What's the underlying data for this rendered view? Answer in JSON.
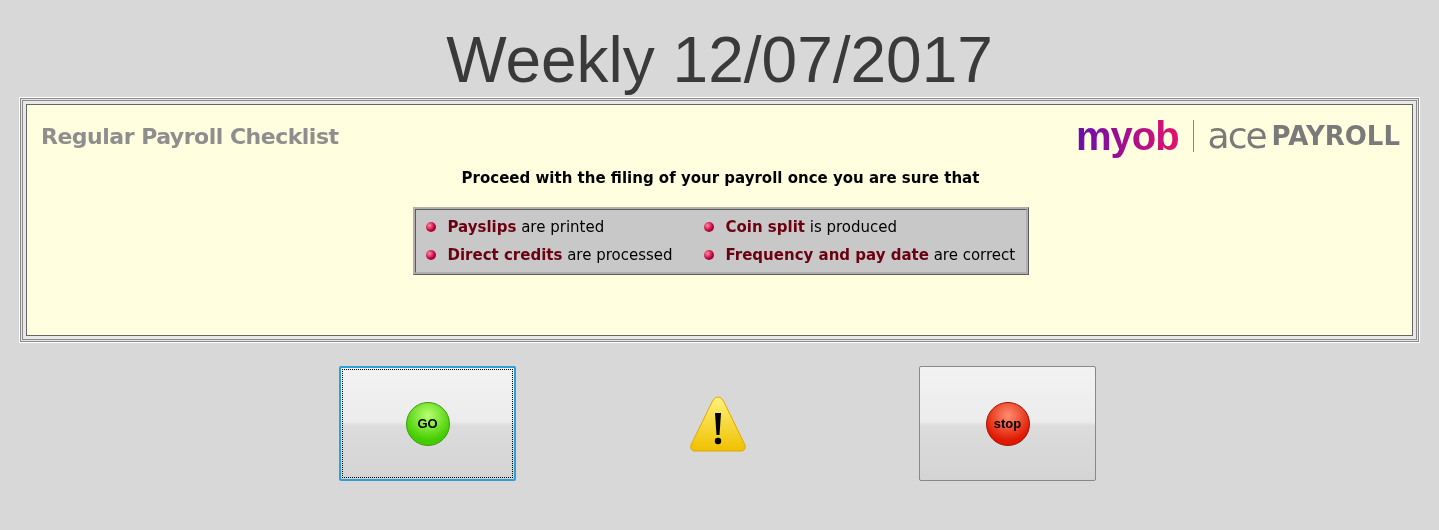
{
  "title": "Weekly 12/07/2017",
  "panel": {
    "heading": "Regular Payroll Checklist",
    "logo": {
      "brand": "myob",
      "product": "ace",
      "product_suffix": "PAYROLL"
    },
    "intro": "Proceed with the filing of your payroll once you are sure that",
    "items": [
      {
        "text": "**Payslips** are printed"
      },
      {
        "text": "**Coin split** is produced"
      },
      {
        "text": "**Direct credits** are processed"
      },
      {
        "text": "**Frequency and pay date** are correct"
      }
    ]
  },
  "buttons": [
    {
      "kind": "go",
      "label": "GO",
      "focused": true
    },
    {
      "kind": "warning"
    },
    {
      "kind": "stop",
      "label": "stop",
      "focused": false
    }
  ]
}
